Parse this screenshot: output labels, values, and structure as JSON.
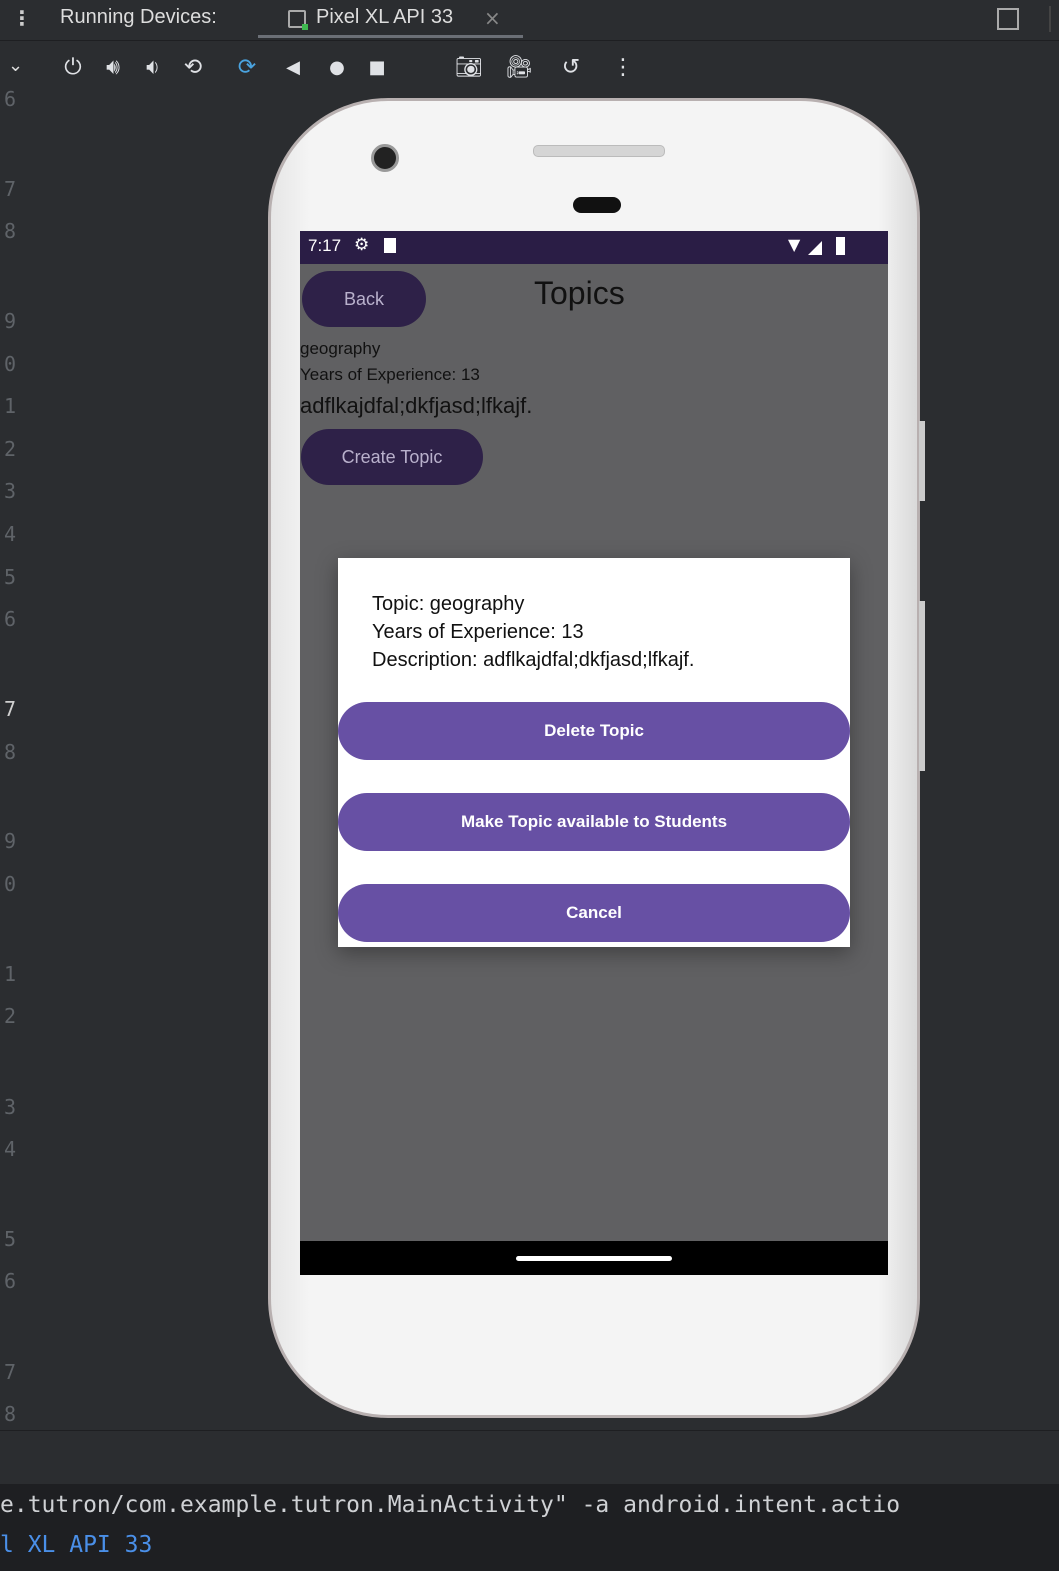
{
  "tabbar": {
    "label": "Running Devices:",
    "tab_title": "Pixel XL API 33",
    "close_glyph": "×"
  },
  "toolbar": {
    "icons": [
      "power-icon",
      "volume-up-icon",
      "volume-down-icon",
      "rotate-left-icon",
      "rotate-right-icon",
      "back-icon",
      "home-icon",
      "overview-icon",
      "screenshot-icon",
      "screen-record-icon",
      "reset-icon",
      "more-icon"
    ]
  },
  "gutter": {
    "line_numbers": [
      "6",
      "7",
      "8",
      "9",
      "0",
      "1",
      "2",
      "3",
      "4",
      "5",
      "6",
      "7",
      "8",
      "9",
      "0",
      "1",
      "2",
      "3",
      "4",
      "5",
      "6",
      "7",
      "8"
    ]
  },
  "status_bar": {
    "time": "7:17"
  },
  "app": {
    "back_label": "Back",
    "title": "Topics",
    "topic_name": "geography",
    "experience": "Years of Experience: 13",
    "description": "adflkajdfal;dkfjasd;lfkajf.",
    "create_label": "Create Topic"
  },
  "dialog": {
    "topic_line": "Topic: geography",
    "experience_line": "Years of Experience: 13",
    "description_line": "Description: adflkajdfal;dkfjasd;lfkajf.",
    "delete_label": "Delete Topic",
    "make_available_label": "Make Topic available to Students",
    "cancel_label": "Cancel"
  },
  "console": {
    "line1": "e.tutron/com.example.tutron.MainActivity\" -a android.intent.actio",
    "line2": "l XL API 33"
  },
  "colors": {
    "accent_purple": "#6750a4",
    "dark_purple": "#2e2148",
    "status_bar": "#2a1d45",
    "console_link": "#4a8fe8"
  }
}
